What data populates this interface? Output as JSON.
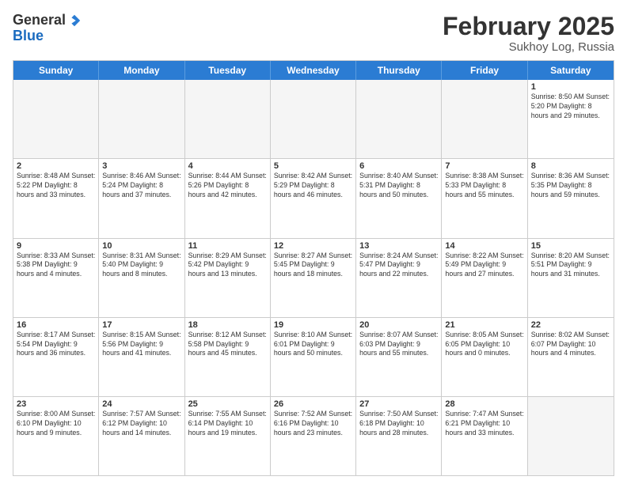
{
  "header": {
    "logo_line1": "General",
    "logo_line2": "Blue",
    "cal_title": "February 2025",
    "cal_subtitle": "Sukhoy Log, Russia"
  },
  "days_of_week": [
    "Sunday",
    "Monday",
    "Tuesday",
    "Wednesday",
    "Thursday",
    "Friday",
    "Saturday"
  ],
  "weeks": [
    [
      {
        "day": "",
        "info": ""
      },
      {
        "day": "",
        "info": ""
      },
      {
        "day": "",
        "info": ""
      },
      {
        "day": "",
        "info": ""
      },
      {
        "day": "",
        "info": ""
      },
      {
        "day": "",
        "info": ""
      },
      {
        "day": "1",
        "info": "Sunrise: 8:50 AM\nSunset: 5:20 PM\nDaylight: 8 hours and 29 minutes."
      }
    ],
    [
      {
        "day": "2",
        "info": "Sunrise: 8:48 AM\nSunset: 5:22 PM\nDaylight: 8 hours and 33 minutes."
      },
      {
        "day": "3",
        "info": "Sunrise: 8:46 AM\nSunset: 5:24 PM\nDaylight: 8 hours and 37 minutes."
      },
      {
        "day": "4",
        "info": "Sunrise: 8:44 AM\nSunset: 5:26 PM\nDaylight: 8 hours and 42 minutes."
      },
      {
        "day": "5",
        "info": "Sunrise: 8:42 AM\nSunset: 5:29 PM\nDaylight: 8 hours and 46 minutes."
      },
      {
        "day": "6",
        "info": "Sunrise: 8:40 AM\nSunset: 5:31 PM\nDaylight: 8 hours and 50 minutes."
      },
      {
        "day": "7",
        "info": "Sunrise: 8:38 AM\nSunset: 5:33 PM\nDaylight: 8 hours and 55 minutes."
      },
      {
        "day": "8",
        "info": "Sunrise: 8:36 AM\nSunset: 5:35 PM\nDaylight: 8 hours and 59 minutes."
      }
    ],
    [
      {
        "day": "9",
        "info": "Sunrise: 8:33 AM\nSunset: 5:38 PM\nDaylight: 9 hours and 4 minutes."
      },
      {
        "day": "10",
        "info": "Sunrise: 8:31 AM\nSunset: 5:40 PM\nDaylight: 9 hours and 8 minutes."
      },
      {
        "day": "11",
        "info": "Sunrise: 8:29 AM\nSunset: 5:42 PM\nDaylight: 9 hours and 13 minutes."
      },
      {
        "day": "12",
        "info": "Sunrise: 8:27 AM\nSunset: 5:45 PM\nDaylight: 9 hours and 18 minutes."
      },
      {
        "day": "13",
        "info": "Sunrise: 8:24 AM\nSunset: 5:47 PM\nDaylight: 9 hours and 22 minutes."
      },
      {
        "day": "14",
        "info": "Sunrise: 8:22 AM\nSunset: 5:49 PM\nDaylight: 9 hours and 27 minutes."
      },
      {
        "day": "15",
        "info": "Sunrise: 8:20 AM\nSunset: 5:51 PM\nDaylight: 9 hours and 31 minutes."
      }
    ],
    [
      {
        "day": "16",
        "info": "Sunrise: 8:17 AM\nSunset: 5:54 PM\nDaylight: 9 hours and 36 minutes."
      },
      {
        "day": "17",
        "info": "Sunrise: 8:15 AM\nSunset: 5:56 PM\nDaylight: 9 hours and 41 minutes."
      },
      {
        "day": "18",
        "info": "Sunrise: 8:12 AM\nSunset: 5:58 PM\nDaylight: 9 hours and 45 minutes."
      },
      {
        "day": "19",
        "info": "Sunrise: 8:10 AM\nSunset: 6:01 PM\nDaylight: 9 hours and 50 minutes."
      },
      {
        "day": "20",
        "info": "Sunrise: 8:07 AM\nSunset: 6:03 PM\nDaylight: 9 hours and 55 minutes."
      },
      {
        "day": "21",
        "info": "Sunrise: 8:05 AM\nSunset: 6:05 PM\nDaylight: 10 hours and 0 minutes."
      },
      {
        "day": "22",
        "info": "Sunrise: 8:02 AM\nSunset: 6:07 PM\nDaylight: 10 hours and 4 minutes."
      }
    ],
    [
      {
        "day": "23",
        "info": "Sunrise: 8:00 AM\nSunset: 6:10 PM\nDaylight: 10 hours and 9 minutes."
      },
      {
        "day": "24",
        "info": "Sunrise: 7:57 AM\nSunset: 6:12 PM\nDaylight: 10 hours and 14 minutes."
      },
      {
        "day": "25",
        "info": "Sunrise: 7:55 AM\nSunset: 6:14 PM\nDaylight: 10 hours and 19 minutes."
      },
      {
        "day": "26",
        "info": "Sunrise: 7:52 AM\nSunset: 6:16 PM\nDaylight: 10 hours and 23 minutes."
      },
      {
        "day": "27",
        "info": "Sunrise: 7:50 AM\nSunset: 6:18 PM\nDaylight: 10 hours and 28 minutes."
      },
      {
        "day": "28",
        "info": "Sunrise: 7:47 AM\nSunset: 6:21 PM\nDaylight: 10 hours and 33 minutes."
      },
      {
        "day": "",
        "info": ""
      }
    ]
  ]
}
